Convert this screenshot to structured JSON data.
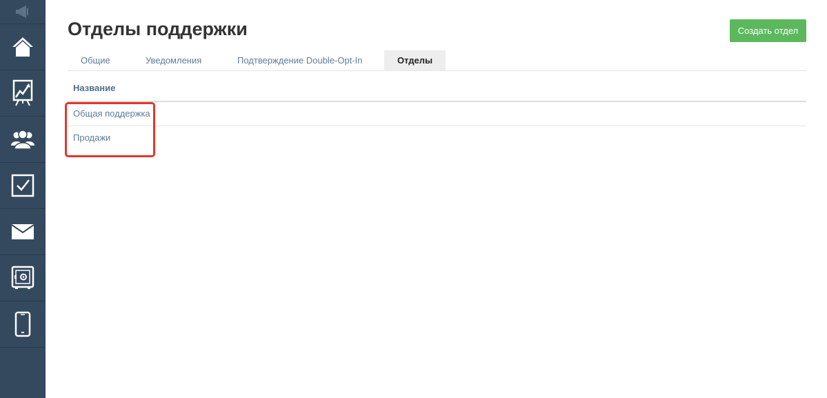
{
  "sidebar": {
    "items": [
      {
        "icon": "home-icon"
      },
      {
        "icon": "chart-icon"
      },
      {
        "icon": "users-icon"
      },
      {
        "icon": "checkbox-icon"
      },
      {
        "icon": "mail-icon"
      },
      {
        "icon": "safe-icon"
      },
      {
        "icon": "mobile-icon"
      }
    ],
    "top_icon": "megaphone-icon",
    "colors": {
      "background": "#34495e",
      "icon": "#ffffff"
    }
  },
  "page": {
    "title": "Отделы поддержки",
    "create_button": "Создать отдел"
  },
  "tabs": [
    {
      "label": "Общие",
      "active": false
    },
    {
      "label": "Уведомления",
      "active": false
    },
    {
      "label": "Подтверждение Double-Opt-In",
      "active": false
    },
    {
      "label": "Отделы",
      "active": true
    }
  ],
  "table": {
    "header": "Название",
    "rows": [
      "Общая поддержка",
      "Продажи"
    ]
  },
  "colors": {
    "accent_button": "#5cb85c",
    "link": "#5d7d9a",
    "highlight": "#e0382b"
  }
}
